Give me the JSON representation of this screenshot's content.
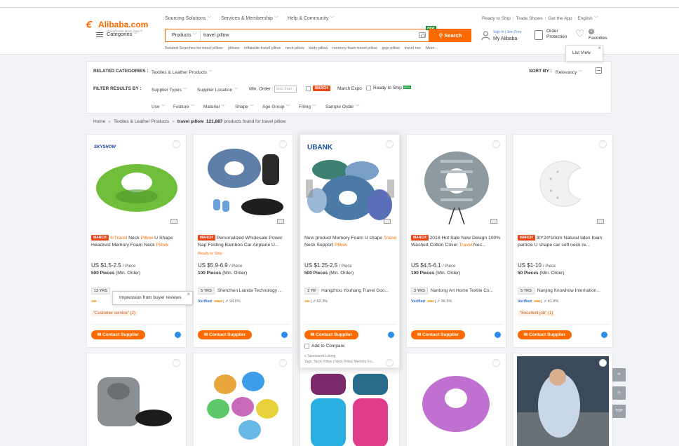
{
  "header": {
    "logo_text": "Alibaba.com",
    "logo_tagline": "Global trade starts here™",
    "nav": [
      "Sourcing Solutions",
      "Services & Membership",
      "Help & Community"
    ],
    "right_nav": [
      "Ready to Ship",
      "Trade Shows",
      "Get the App",
      "English"
    ],
    "categories_label": "Categories",
    "search": {
      "scope": "Products",
      "value": "travel pillow",
      "button": "Search",
      "new_badge": "NEW"
    },
    "related_prefix": "Related Searches for travel pillow:",
    "related": [
      "pillows",
      "inflatable travel pillow",
      "neck pillow",
      "body pillow",
      "memory foam travel pillow",
      "gojo pillow",
      "travel nec",
      "More..."
    ],
    "sign_in": "Sign In",
    "join_free": "Join Free",
    "my_alibaba": "My Alibaba",
    "order_protection_1": "Order",
    "order_protection_2": "Protection",
    "favorites_count": "0",
    "favorites_label": "Favorites",
    "list_view_tip": "List View"
  },
  "filters": {
    "related_categories_label": "RELATED CATEGORIES :",
    "related_category": "Textiles & Leather Products",
    "sort_label": "SORT BY :",
    "sort_value": "Relevancy",
    "filter_label": "FILTER RESULTS BY :",
    "supplier_types": "Supplier Types",
    "supplier_location": "Supplier Location",
    "min_order_label": "Min. Order :",
    "min_order_placeholder": "less than",
    "march_badge": "MARCH",
    "march_expo": "March Expo",
    "ready_to_ship": "Ready to Ship",
    "new_tag": "NEW",
    "attributes": [
      "Use",
      "Feature",
      "Material",
      "Shape",
      "Age Group",
      "Filling",
      "Sample Order"
    ]
  },
  "breadcrumb": {
    "home": "Home",
    "category": "Textiles & Leather Products",
    "current": "travel pillow",
    "count": "121,887",
    "count_suffix": "products found for travel pillow"
  },
  "cards": [
    {
      "brand": "SKYSHOW",
      "title_pre": "",
      "title_hl1": "Travel",
      "title_mid": " Neck ",
      "title_hl2": "Pillow",
      "title_post": " U Shape Headrest Memory Foam Neck ",
      "title_hl3": "Pillow",
      "price": "US $1.5-2.5",
      "unit": "/ Piece",
      "moq_qty": "500 Pieces",
      "moq_label": "(Min. Order)",
      "years": "13",
      "yrs_label": "YRS",
      "supplier": "",
      "verified": "",
      "rating": "",
      "review": "\"Customer service\" (2)",
      "ready": "",
      "color": "#7ac943"
    },
    {
      "brand": "",
      "title_pre": "Personalized Wholesale Power Nap Folding Bamboo Car Airplane U...",
      "price": "US $5.9-6.9",
      "unit": "/ Piece",
      "moq_qty": "100 Pieces",
      "moq_label": "(Min. Order)",
      "years": "5",
      "yrs_label": "YRS",
      "supplier": "Shenzhen Lianda Technology ...",
      "verified": "Verified",
      "rating": "94.6%",
      "review": "",
      "ready": "Ready to Ship",
      "color": "#5e7fa8"
    },
    {
      "brand": "UBANK",
      "title_pre": "New product Memory Foam U shape ",
      "title_hl1": "Travel",
      "title_mid": " Neck Support ",
      "title_hl2": "Pillow",
      "price": "US $1.25-2.5",
      "unit": "/ Piece",
      "moq_qty": "500 Pieces",
      "moq_label": "(Min. Order)",
      "years": "1",
      "yrs_label": "YR",
      "supplier": "Hangzhou Youhang Travel Goo...",
      "verified": "",
      "rating": "62.3%",
      "review": "",
      "ready": "",
      "compare": "Add to Compare",
      "sponsored": "Sponsored Listing",
      "tags": "Tags: Neck Pillow | Neck Pillow Memory Fo...",
      "color": "#4c7aa6"
    },
    {
      "brand": "",
      "title_pre": "2018 Hot Sale New Design 100% Washed Cotton Cover ",
      "title_hl1": "Travel",
      "title_mid": " Nec...",
      "price": "US $4.5-6.1",
      "unit": "/ Piece",
      "moq_qty": "100 Pieces",
      "moq_label": "(Min. Order)",
      "years": "3",
      "yrs_label": "YRS",
      "supplier": "Nantong Art Home Textile Co...",
      "verified": "Verified",
      "rating": "96.5%",
      "review": "",
      "ready": "",
      "color": "#8d9aa0"
    },
    {
      "brand": "",
      "title_pre": "30*24*10cm Natural latex foam particle U shape car soft neck re...",
      "price": "US $1-10",
      "unit": "/ Piece",
      "moq_qty": "50 Pieces",
      "moq_label": "(Min. Order)",
      "years": "5",
      "yrs_label": "YRS",
      "supplier": "Nanjing Knowhow Internation...",
      "verified": "Verified",
      "rating": "41.8%",
      "review": "\"Excellent job\" (1)",
      "ready": "",
      "color": "#f2f2f2"
    }
  ],
  "contact_label": "Contact Supplier",
  "tooltip": "Impression from buyer reviews",
  "side": {
    "top": "TOP"
  }
}
